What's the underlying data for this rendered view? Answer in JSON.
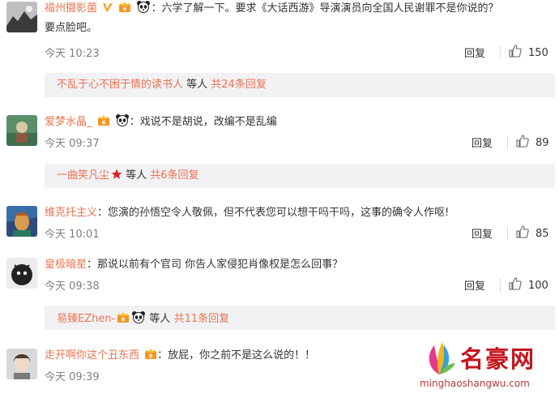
{
  "comments": [
    {
      "user": "福州摄影菌",
      "text": "：六学了解一下。要求《大话西游》导演演员向全国人民谢罪不是你说的？",
      "text_line2": "要点脸吧。",
      "time": "今天 10:23",
      "reply": "回复",
      "likes": "150",
      "sub": {
        "user": "不乱于心不困于情的读书人",
        "mid": " 等人 ",
        "count": "共24条回复"
      }
    },
    {
      "user": "爱梦水晶_",
      "text": "：戏说不是胡说，改编不是乱编",
      "time": "今天 09:37",
      "reply": "回复",
      "likes": "89",
      "sub": {
        "user": "一曲笑凡尘",
        "mid": " 等人 ",
        "count": "共6条回复"
      }
    },
    {
      "user": "维克托主义",
      "text": "：您演的孙悟空令人敬佩，但不代表您可以想干吗干吗，这事的确令人作呕!",
      "time": "今天 10:01",
      "reply": "回复",
      "likes": "85"
    },
    {
      "user": "皇极暗星",
      "text": "：那说以前有个官司 你告人家侵犯肖像权是怎么回事？",
      "time": "今天 09:38",
      "reply": "回复",
      "likes": "100",
      "sub": {
        "user": "易臻EZhen-",
        "mid": " 等人 ",
        "count": "共11条回复"
      }
    },
    {
      "user": "走开啊你这个丑东西",
      "text": "：放屁，你之前不是这么说的！！",
      "time": "今天 09:39",
      "reply": "回复"
    }
  ],
  "watermark": {
    "title": "名豪网",
    "url": "minghaoshangwu.com"
  },
  "colors": {
    "username": "#eb7350",
    "meta": "#808080",
    "subbox": "#f2f2f5",
    "watermark": "#c4151c"
  }
}
